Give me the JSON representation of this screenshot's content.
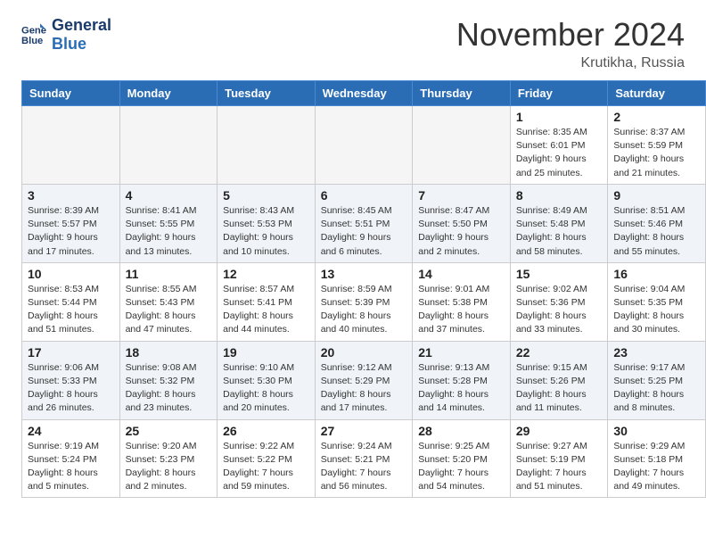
{
  "header": {
    "logo_line1": "General",
    "logo_line2": "Blue",
    "month_title": "November 2024",
    "location": "Krutikha, Russia"
  },
  "days_of_week": [
    "Sunday",
    "Monday",
    "Tuesday",
    "Wednesday",
    "Thursday",
    "Friday",
    "Saturday"
  ],
  "weeks": [
    [
      {
        "day": "",
        "info": ""
      },
      {
        "day": "",
        "info": ""
      },
      {
        "day": "",
        "info": ""
      },
      {
        "day": "",
        "info": ""
      },
      {
        "day": "",
        "info": ""
      },
      {
        "day": "1",
        "info": "Sunrise: 8:35 AM\nSunset: 6:01 PM\nDaylight: 9 hours and 25 minutes."
      },
      {
        "day": "2",
        "info": "Sunrise: 8:37 AM\nSunset: 5:59 PM\nDaylight: 9 hours and 21 minutes."
      }
    ],
    [
      {
        "day": "3",
        "info": "Sunrise: 8:39 AM\nSunset: 5:57 PM\nDaylight: 9 hours and 17 minutes."
      },
      {
        "day": "4",
        "info": "Sunrise: 8:41 AM\nSunset: 5:55 PM\nDaylight: 9 hours and 13 minutes."
      },
      {
        "day": "5",
        "info": "Sunrise: 8:43 AM\nSunset: 5:53 PM\nDaylight: 9 hours and 10 minutes."
      },
      {
        "day": "6",
        "info": "Sunrise: 8:45 AM\nSunset: 5:51 PM\nDaylight: 9 hours and 6 minutes."
      },
      {
        "day": "7",
        "info": "Sunrise: 8:47 AM\nSunset: 5:50 PM\nDaylight: 9 hours and 2 minutes."
      },
      {
        "day": "8",
        "info": "Sunrise: 8:49 AM\nSunset: 5:48 PM\nDaylight: 8 hours and 58 minutes."
      },
      {
        "day": "9",
        "info": "Sunrise: 8:51 AM\nSunset: 5:46 PM\nDaylight: 8 hours and 55 minutes."
      }
    ],
    [
      {
        "day": "10",
        "info": "Sunrise: 8:53 AM\nSunset: 5:44 PM\nDaylight: 8 hours and 51 minutes."
      },
      {
        "day": "11",
        "info": "Sunrise: 8:55 AM\nSunset: 5:43 PM\nDaylight: 8 hours and 47 minutes."
      },
      {
        "day": "12",
        "info": "Sunrise: 8:57 AM\nSunset: 5:41 PM\nDaylight: 8 hours and 44 minutes."
      },
      {
        "day": "13",
        "info": "Sunrise: 8:59 AM\nSunset: 5:39 PM\nDaylight: 8 hours and 40 minutes."
      },
      {
        "day": "14",
        "info": "Sunrise: 9:01 AM\nSunset: 5:38 PM\nDaylight: 8 hours and 37 minutes."
      },
      {
        "day": "15",
        "info": "Sunrise: 9:02 AM\nSunset: 5:36 PM\nDaylight: 8 hours and 33 minutes."
      },
      {
        "day": "16",
        "info": "Sunrise: 9:04 AM\nSunset: 5:35 PM\nDaylight: 8 hours and 30 minutes."
      }
    ],
    [
      {
        "day": "17",
        "info": "Sunrise: 9:06 AM\nSunset: 5:33 PM\nDaylight: 8 hours and 26 minutes."
      },
      {
        "day": "18",
        "info": "Sunrise: 9:08 AM\nSunset: 5:32 PM\nDaylight: 8 hours and 23 minutes."
      },
      {
        "day": "19",
        "info": "Sunrise: 9:10 AM\nSunset: 5:30 PM\nDaylight: 8 hours and 20 minutes."
      },
      {
        "day": "20",
        "info": "Sunrise: 9:12 AM\nSunset: 5:29 PM\nDaylight: 8 hours and 17 minutes."
      },
      {
        "day": "21",
        "info": "Sunrise: 9:13 AM\nSunset: 5:28 PM\nDaylight: 8 hours and 14 minutes."
      },
      {
        "day": "22",
        "info": "Sunrise: 9:15 AM\nSunset: 5:26 PM\nDaylight: 8 hours and 11 minutes."
      },
      {
        "day": "23",
        "info": "Sunrise: 9:17 AM\nSunset: 5:25 PM\nDaylight: 8 hours and 8 minutes."
      }
    ],
    [
      {
        "day": "24",
        "info": "Sunrise: 9:19 AM\nSunset: 5:24 PM\nDaylight: 8 hours and 5 minutes."
      },
      {
        "day": "25",
        "info": "Sunrise: 9:20 AM\nSunset: 5:23 PM\nDaylight: 8 hours and 2 minutes."
      },
      {
        "day": "26",
        "info": "Sunrise: 9:22 AM\nSunset: 5:22 PM\nDaylight: 7 hours and 59 minutes."
      },
      {
        "day": "27",
        "info": "Sunrise: 9:24 AM\nSunset: 5:21 PM\nDaylight: 7 hours and 56 minutes."
      },
      {
        "day": "28",
        "info": "Sunrise: 9:25 AM\nSunset: 5:20 PM\nDaylight: 7 hours and 54 minutes."
      },
      {
        "day": "29",
        "info": "Sunrise: 9:27 AM\nSunset: 5:19 PM\nDaylight: 7 hours and 51 minutes."
      },
      {
        "day": "30",
        "info": "Sunrise: 9:29 AM\nSunset: 5:18 PM\nDaylight: 7 hours and 49 minutes."
      }
    ]
  ]
}
